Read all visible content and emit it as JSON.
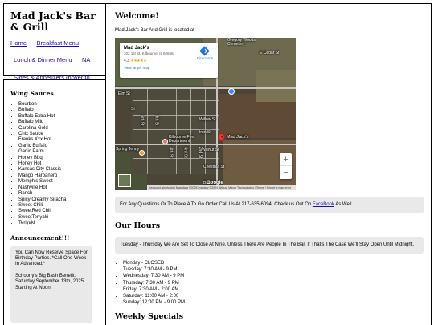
{
  "site": {
    "title": "Mad Jack's Bar & Grill",
    "nav": {
      "home": "Home",
      "breakfast_menu": "Breakfast Menu",
      "lunch_dinner_menu": "Lunch & Dinner Menu",
      "na": "NA",
      "sides_appetizers": "Sides & Appetizers (hover to show)"
    }
  },
  "sidebar": {
    "wing_sauces_heading": "Wing Sauces",
    "wing_sauces": [
      "Bourbon",
      "Buffalo",
      "Buffalo Extra Hot",
      "Buffalo Mild",
      "Carolina Gold",
      "Chix Sauce",
      "Franks Xxx Hot",
      "Garlic Buffalo",
      "Garlic Parm",
      "Honey Bbq",
      "Honey Hot",
      "Kansas City Classic",
      "Mango Harbanero",
      "Memphis Sweet",
      "Nashville Hot",
      "Ranch",
      "Spicy Creamy Siracha",
      "Sweet Chili",
      "SweetRed Chili",
      "SweetTeriyaki",
      "Teriyaki"
    ],
    "announcement_heading": "Announcement!!!",
    "announcement_paragraphs": [
      "You Can Now Reserve Space For Birthday Parties. *Call One Week In Advanced.*",
      "Schoony's Big Bash Benefit: Saturday September 13th, 2025 Starting At Noon."
    ]
  },
  "main": {
    "welcome_heading": "Welcome!",
    "location_text": "Mad Jack's Bar And Grill is located at",
    "map": {
      "place_name": "Mad Jack's",
      "address": "102 1st St, Kilbourne, IL 62655",
      "rating": "4.3",
      "stars": "★★★★★",
      "larger_map_link": "View larger map",
      "directions_label": "Directions",
      "pin_label": "Mad Jack's",
      "street_labels": [
        "Elm St",
        "Kilbourne Fire Department",
        "Walnut St",
        "Chestnut St",
        "Birch St",
        "Willow St",
        "Iron St",
        "Gregory Woods Cemetery",
        "E Cedar St",
        "6th St",
        "5th St",
        "4th St",
        "3rd St",
        "2nd St",
        "Spring Jenny",
        "St"
      ],
      "zoom_in": "+",
      "zoom_out": "−",
      "google_logo": "Google",
      "attribution": "Keyboard shortcuts | Map data ©2025 Imagery ©2025 Airbus, Maxar Technologies | Terms | Report a map error"
    },
    "order_text_prefix": "For Any Questions Or To Place A To Go Order Call Us At 217-635-6094. Check us Out On ",
    "facebook_link": "FaceBook",
    "order_text_suffix": " As Well",
    "hours_heading": "Our Hours",
    "hours_notice": "Tuesday - Thursday We Are Set To Close At Nine, Unless There Are People In The Bar. If That's The Case We'll Stay Open Until Midnight.",
    "hours": [
      "Monday - CLOSED",
      "Tuesday: 7:30 AM - 9 PM",
      "Wednesday: 7:30 AM - 9 PM",
      "Thursday: 7:30 AM - 9 PM",
      "Friday: 7:30 AM - 2:00 AM",
      "Saturday: 11:00 AM - 2:00",
      "Sunday: 12:00 PM - 9:00 PM"
    ],
    "specials_heading": "Weekly Specials"
  }
}
